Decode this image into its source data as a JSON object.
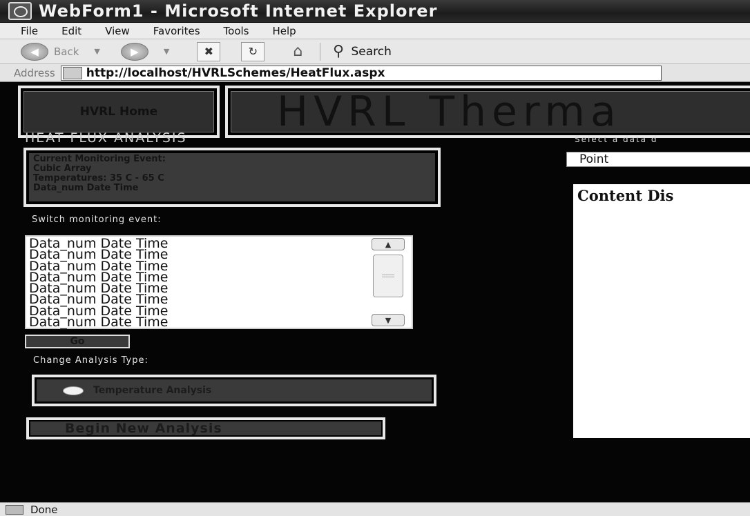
{
  "window": {
    "title": "WebForm1 - Microsoft Internet Explorer"
  },
  "menu": [
    "File",
    "Edit",
    "View",
    "Favorites",
    "Tools",
    "Help"
  ],
  "toolbar": {
    "back_label": "Back",
    "search_label": "Search"
  },
  "address": {
    "label": "Address",
    "url": "http://localhost/HVRLSchemes/HeatFlux.aspx"
  },
  "header": {
    "home_label": "HVRL Home",
    "banner_title": "HVRL Therma"
  },
  "left": {
    "section_title": "HEAT FLUX ANALYSIS",
    "event_lines": [
      "Current Monitoring Event:",
      "Cubic Array",
      "Temperatures: 35 C - 65 C",
      "Data_num Date Time"
    ],
    "switch_label": "Switch monitoring event:",
    "list_items": [
      "Data_num Date Time",
      "Data_num Date Time",
      "Data_num Date Time",
      "Data_num Date Time",
      "Data_num Date Time",
      "Data_num Date Time",
      "Data_num Date Time",
      "Data_num Date Time"
    ],
    "go_label": "Go",
    "change_label": "Change Analysis Type:",
    "radio_label": "Temperature Analysis",
    "new_analysis_label": "Begin New Analysis"
  },
  "right": {
    "select_label": "Select a data d",
    "select_value": "Point",
    "content_title": "Content Dis"
  },
  "status": {
    "text": "Done"
  }
}
